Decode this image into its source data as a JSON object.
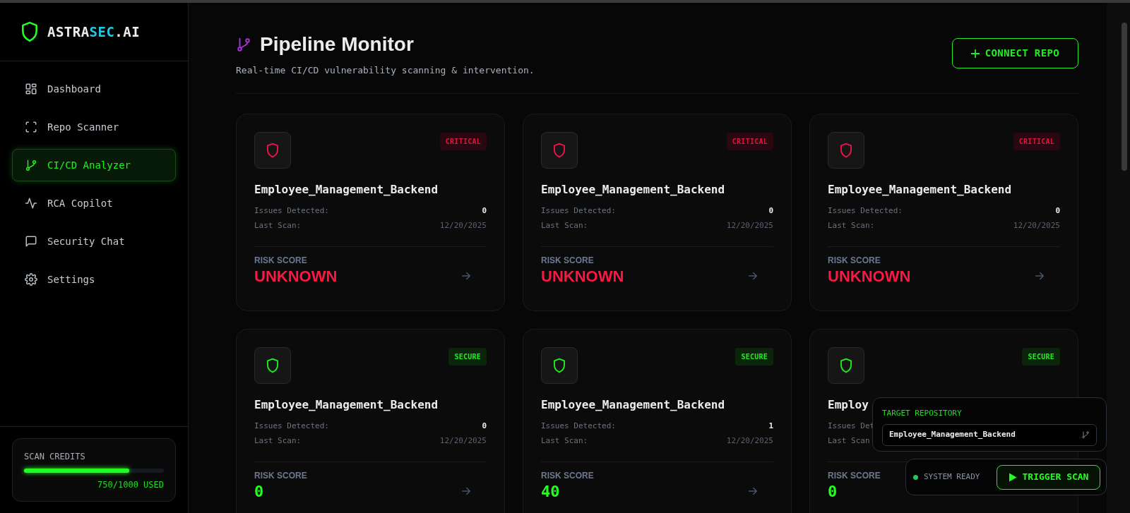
{
  "sidebar": {
    "logo": {
      "prefix": "ASTRA",
      "accent": "SEC",
      "suffix": ".AI"
    },
    "items": [
      {
        "label": "Dashboard",
        "selected": false
      },
      {
        "label": "Repo Scanner",
        "selected": false
      },
      {
        "label": "CI/CD Analyzer",
        "selected": true
      },
      {
        "label": "RCA Copilot",
        "selected": false
      },
      {
        "label": "Security Chat",
        "selected": false
      },
      {
        "label": "Settings",
        "selected": false
      }
    ],
    "credits": {
      "title": "SCAN CREDITS",
      "level": 0.75,
      "reading": "750/1000 USED"
    }
  },
  "header": {
    "title": "Pipeline Monitor",
    "subtitle": "Real-time CI/CD vulnerability scanning & intervention.",
    "button": "CONNECT REPO"
  },
  "cards": [
    {
      "kind": "critical",
      "badge": "CRITICAL",
      "title": "Employee_Management_Backend",
      "issues_label": "Issues Detected:",
      "issues": "0",
      "last_scan_label": "Last Scan:",
      "last_scan": "12/20/2025",
      "risk_label": "RISK SCORE",
      "risk": "UNKNOWN"
    },
    {
      "kind": "critical",
      "badge": "CRITICAL",
      "title": "Employee_Management_Backend",
      "issues_label": "Issues Detected:",
      "issues": "0",
      "last_scan_label": "Last Scan:",
      "last_scan": "12/20/2025",
      "risk_label": "RISK SCORE",
      "risk": "UNKNOWN"
    },
    {
      "kind": "critical",
      "badge": "CRITICAL",
      "title": "Employee_Management_Backend",
      "issues_label": "Issues Detected:",
      "issues": "0",
      "last_scan_label": "Last Scan:",
      "last_scan": "12/20/2025",
      "risk_label": "RISK SCORE",
      "risk": "UNKNOWN"
    },
    {
      "kind": "secure",
      "badge": "SECURE",
      "title": "Employee_Management_Backend",
      "issues_label": "Issues Detected:",
      "issues": "0",
      "last_scan_label": "Last Scan:",
      "last_scan": "12/20/2025",
      "risk_label": "RISK SCORE",
      "risk": "0"
    },
    {
      "kind": "secure",
      "badge": "SECURE",
      "title": "Employee_Management_Backend",
      "issues_label": "Issues Detected:",
      "issues": "1",
      "last_scan_label": "Last Scan:",
      "last_scan": "12/20/2025",
      "risk_label": "RISK SCORE",
      "risk": "40"
    },
    {
      "kind": "secure",
      "badge": "SECURE",
      "title": "Employ",
      "issues_label": "Issues Det",
      "last_scan_label": "Last Scan",
      "risk_label": "RISK SCORE",
      "risk": "0"
    }
  ],
  "target_panel": {
    "label": "TARGET REPOSITORY",
    "value": "Employee_Management_Backend"
  },
  "status_panel": {
    "status": "SYSTEM READY",
    "button": "TRIGGER SCAN"
  }
}
